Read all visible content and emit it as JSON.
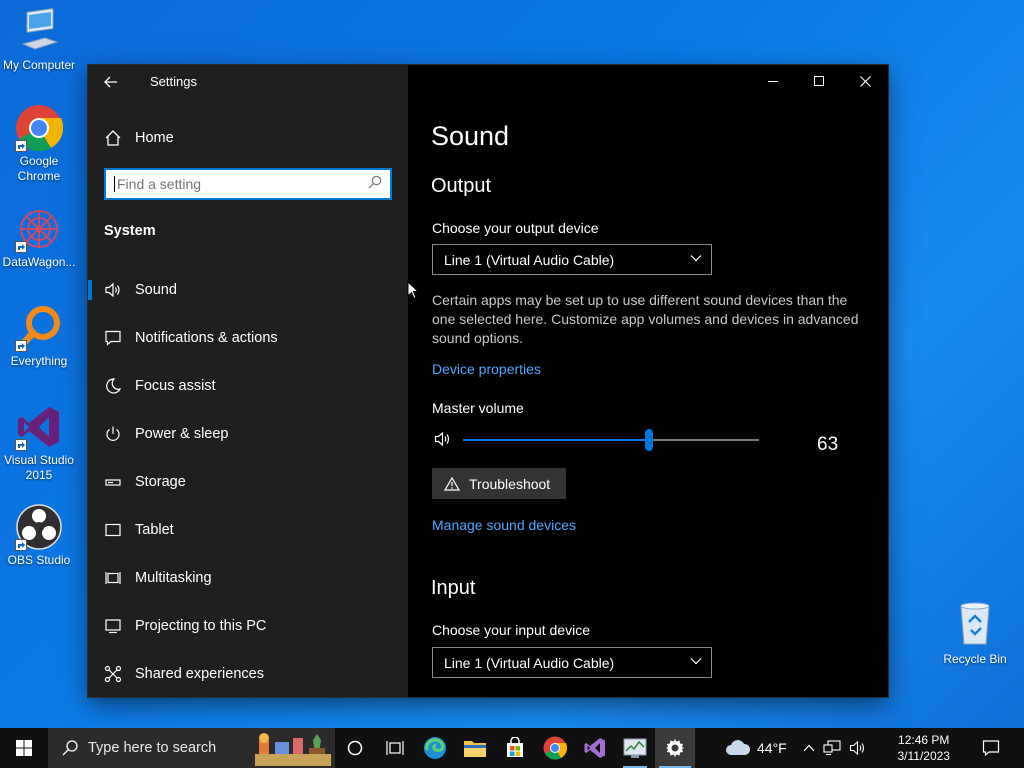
{
  "desktop": {
    "icons": [
      {
        "label": "My Computer"
      },
      {
        "label": "Google Chrome"
      },
      {
        "label": "DataWagon..."
      },
      {
        "label": "Everything"
      },
      {
        "label": "Visual Studio 2015"
      },
      {
        "label": "OBS Studio"
      }
    ],
    "recycle_bin": {
      "label": "Recycle Bin"
    }
  },
  "window": {
    "title": "Settings",
    "home_label": "Home",
    "search": {
      "placeholder": "Find a setting",
      "value": ""
    },
    "section": "System",
    "nav": [
      {
        "label": "Sound",
        "icon": "speaker-icon",
        "selected": true
      },
      {
        "label": "Notifications & actions",
        "icon": "message-icon"
      },
      {
        "label": "Focus assist",
        "icon": "moon-icon"
      },
      {
        "label": "Power & sleep",
        "icon": "power-icon"
      },
      {
        "label": "Storage",
        "icon": "storage-icon"
      },
      {
        "label": "Tablet",
        "icon": "tablet-icon"
      },
      {
        "label": "Multitasking",
        "icon": "multitasking-icon"
      },
      {
        "label": "Projecting to this PC",
        "icon": "projector-icon"
      },
      {
        "label": "Shared experiences",
        "icon": "shared-icon"
      }
    ]
  },
  "sound": {
    "title": "Sound",
    "output": {
      "heading": "Output",
      "device_label": "Choose your output device",
      "device_value": "Line 1 (Virtual Audio Cable)",
      "description": "Certain apps may be set up to use different sound devices than the one selected here. Customize app volumes and devices in advanced sound options.",
      "device_properties_link": "Device properties",
      "master_volume_label": "Master volume",
      "master_volume_value": 63,
      "master_volume_display": "63",
      "troubleshoot_label": "Troubleshoot",
      "manage_link": "Manage sound devices"
    },
    "input": {
      "heading": "Input",
      "device_label": "Choose your input device",
      "device_value": "Line 1 (Virtual Audio Cable)"
    }
  },
  "taskbar": {
    "search_placeholder": "Type here to search",
    "weather": "44°F",
    "time": "12:46 PM",
    "date": "3/11/2023"
  },
  "colors": {
    "accent": "#0078d7",
    "link": "#4ea6ff",
    "sidebar_bg": "#1f1f1f",
    "content_bg": "#000000"
  }
}
